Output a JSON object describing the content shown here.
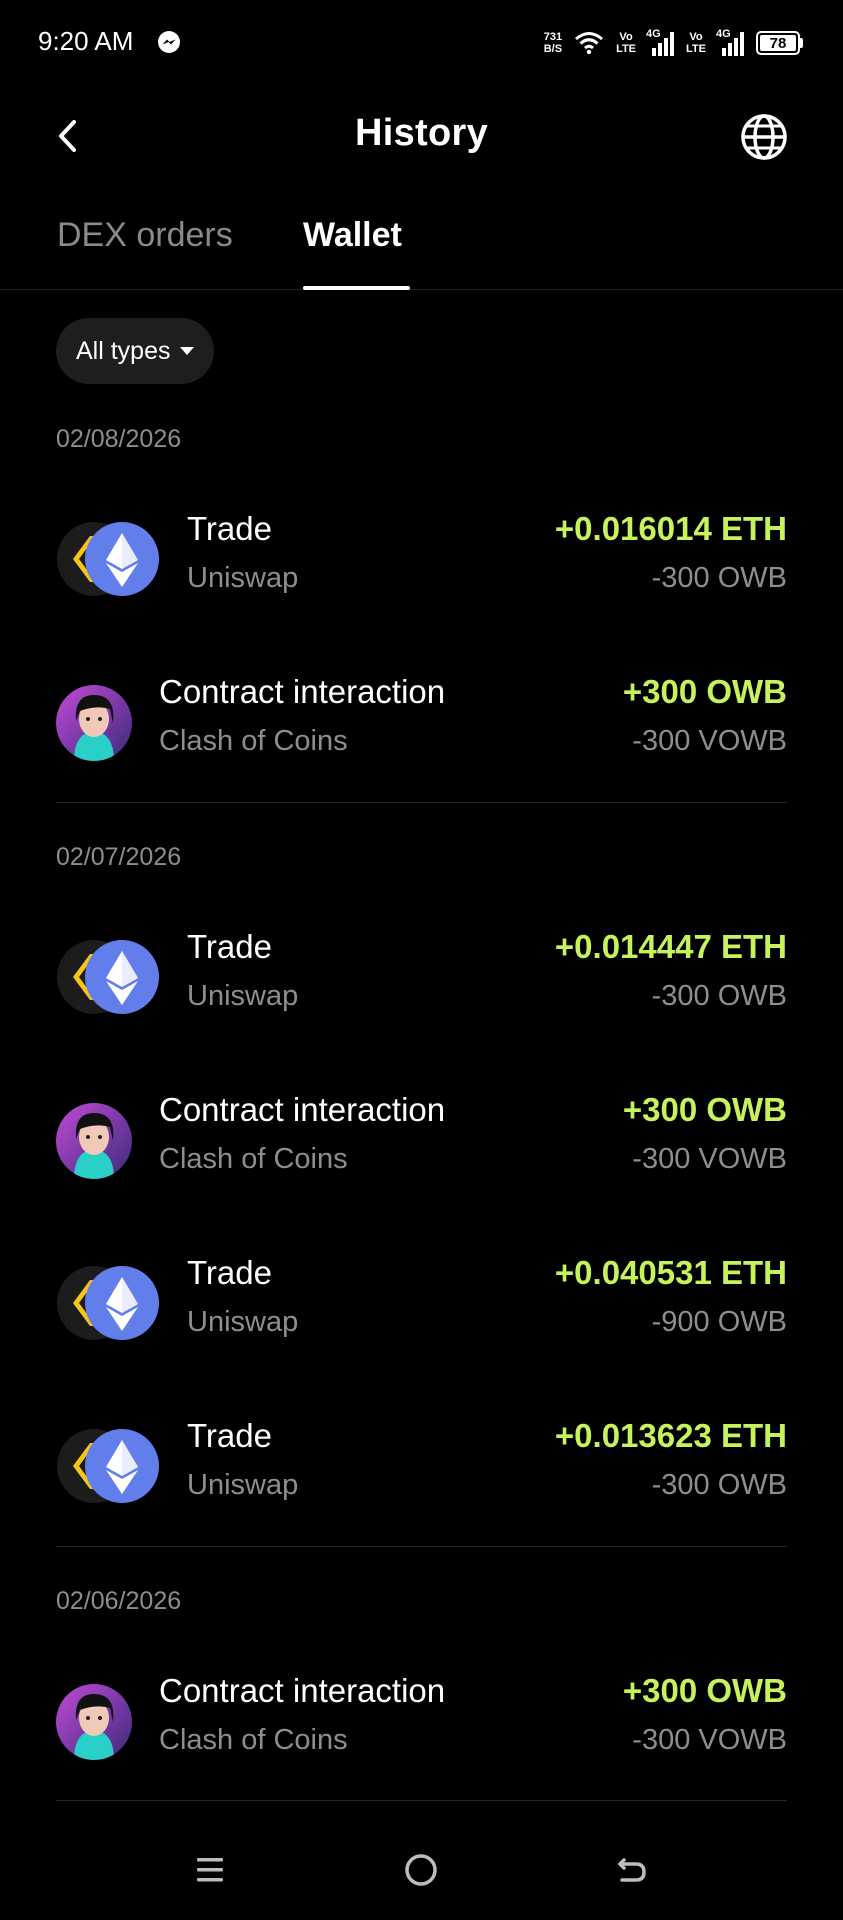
{
  "status_bar": {
    "time": "9:20 AM",
    "net_speed_value": "731",
    "net_speed_unit": "B/S",
    "volte_top": "Vo",
    "volte_bottom": "LTE",
    "network": "4G",
    "battery": "78"
  },
  "header": {
    "title": "History"
  },
  "tabs": [
    {
      "label": "DEX orders",
      "active": false
    },
    {
      "label": "Wallet",
      "active": true
    }
  ],
  "filter": {
    "label": "All types"
  },
  "groups": [
    {
      "date": "02/08/2026",
      "transactions": [
        {
          "kind": "trade",
          "title": "Trade",
          "subtitle": "Uniswap",
          "amount": "+0.016014 ETH",
          "amount2": "-300 OWB"
        },
        {
          "kind": "contract",
          "title": "Contract interaction",
          "subtitle": "Clash of Coins",
          "amount": "+300 OWB",
          "amount2": "-300 VOWB"
        }
      ]
    },
    {
      "date": "02/07/2026",
      "transactions": [
        {
          "kind": "trade",
          "title": "Trade",
          "subtitle": "Uniswap",
          "amount": "+0.014447 ETH",
          "amount2": "-300 OWB"
        },
        {
          "kind": "contract",
          "title": "Contract interaction",
          "subtitle": "Clash of Coins",
          "amount": "+300 OWB",
          "amount2": "-300 VOWB"
        },
        {
          "kind": "trade",
          "title": "Trade",
          "subtitle": "Uniswap",
          "amount": "+0.040531 ETH",
          "amount2": "-900 OWB"
        },
        {
          "kind": "trade",
          "title": "Trade",
          "subtitle": "Uniswap",
          "amount": "+0.013623 ETH",
          "amount2": "-300 OWB"
        }
      ]
    },
    {
      "date": "02/06/2026",
      "transactions": [
        {
          "kind": "contract",
          "title": "Contract interaction",
          "subtitle": "Clash of Coins",
          "amount": "+300 OWB",
          "amount2": "-300 VOWB"
        }
      ]
    }
  ],
  "colors": {
    "background": "#000000",
    "positive_amount": "#c6f35b",
    "secondary_text": "#8e8e8e",
    "eth_blue": "#627eea",
    "owb_yellow": "#f5c518"
  },
  "icons": {
    "back": "chevron-left-icon",
    "globe": "globe-icon",
    "filter_caret": "caret-down-icon",
    "trade_token_a": "owb-token-icon",
    "trade_token_b": "ethereum-icon",
    "contract": "clash-of-coins-avatar",
    "nav_menu": "menu-icon",
    "nav_home": "home-circle-icon",
    "nav_back": "back-arrow-icon"
  }
}
